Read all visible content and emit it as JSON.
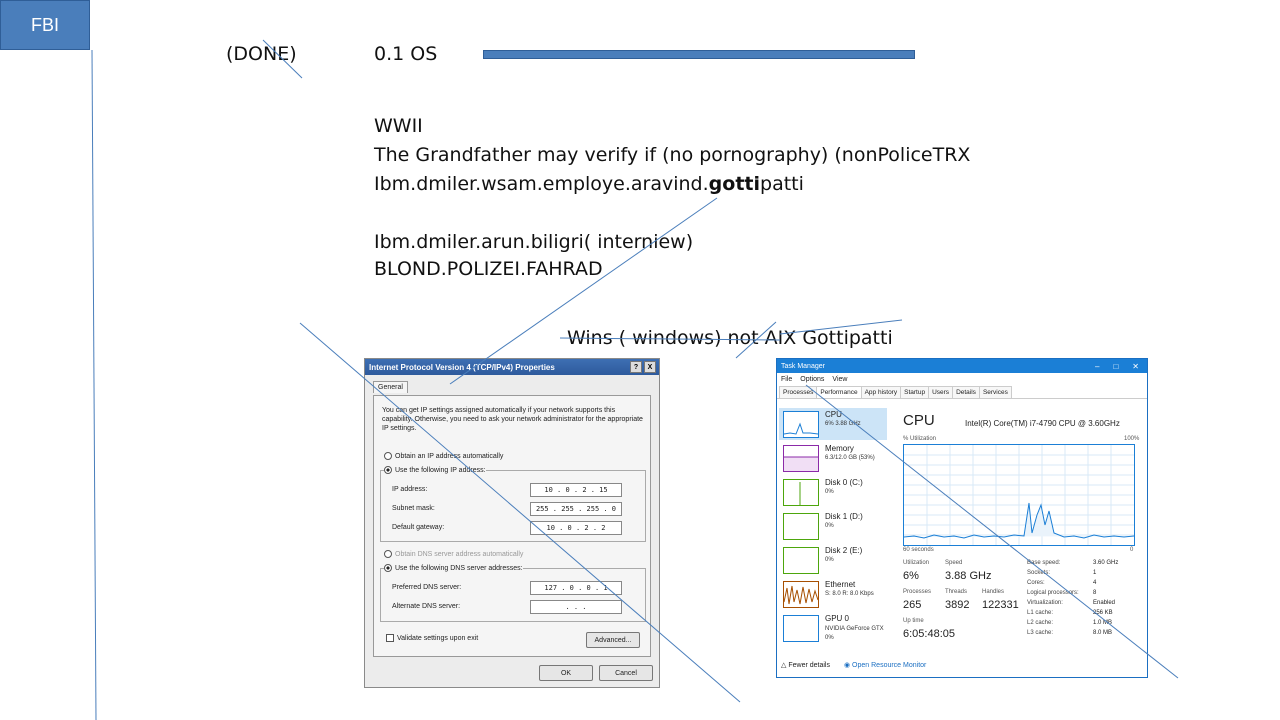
{
  "header": {
    "fbi_label": "FBI"
  },
  "slide": {
    "done": "(DONE)",
    "os": "0.1 OS",
    "line1": "WWII",
    "line2": "The Grandfather may verify if (no pornography) (nonPoliceTRX",
    "line3_prefix": "Ibm.dmiler.wsam.employe.aravind.",
    "line3_bold": "gotti",
    "line3_suffix": "patti",
    "line4": "Ibm.dmiler.arun.biligri( interniew)",
    "line5": "BLOND.POLIZEI.FAHRAD",
    "caption": "Wins ( windows) not AIX Gottipatti"
  },
  "ipv4_dialog": {
    "title": "Internet Protocol Version 4 (TCP/IPv4) Properties",
    "help": "?",
    "close": "X",
    "tab": "General",
    "description": "You can get IP settings assigned automatically if your network supports this capability. Otherwise, you need to ask your network administrator for the appropriate IP settings.",
    "auto_ip": "Obtain an IP address automatically",
    "manual_ip": "Use the following IP address:",
    "ip_label": "IP address:",
    "ip_value": "10 . 0 . 2 . 15",
    "mask_label": "Subnet mask:",
    "mask_value": "255 . 255 . 255 . 0",
    "gw_label": "Default gateway:",
    "gw_value": "10 . 0 . 2 . 2",
    "auto_dns": "Obtain DNS server address automatically",
    "manual_dns": "Use the following DNS server addresses:",
    "pref_dns_label": "Preferred DNS server:",
    "pref_dns_value": "127 . 0 . 0 . 1",
    "alt_dns_label": "Alternate DNS server:",
    "alt_dns_value": ". . .",
    "validate": "Validate settings upon exit",
    "advanced": "Advanced...",
    "ok": "OK",
    "cancel": "Cancel"
  },
  "task_manager": {
    "title": "Task Manager",
    "menu": [
      "File",
      "Options",
      "View"
    ],
    "tabs": [
      "Processes",
      "Performance",
      "App history",
      "Startup",
      "Users",
      "Details",
      "Services"
    ],
    "resources": [
      {
        "name": "CPU",
        "sub": "6% 3.88 GHz"
      },
      {
        "name": "Memory",
        "sub": "6.3/12.0 GB (53%)"
      },
      {
        "name": "Disk 0 (C:)",
        "sub": "0%"
      },
      {
        "name": "Disk 1 (D:)",
        "sub": "0%"
      },
      {
        "name": "Disk 2 (E:)",
        "sub": "0%"
      },
      {
        "name": "Ethernet",
        "sub": "S: 8.0 R: 8.0 Kbps"
      },
      {
        "name": "GPU 0",
        "sub": "NVIDIA GeForce GTX 0%"
      }
    ],
    "cpu_heading": "CPU",
    "cpu_model": "Intel(R) Core(TM) i7-4790 CPU @ 3.60GHz",
    "util_label": "% Utilization",
    "util_max": "100%",
    "time_label": "60 seconds",
    "time_zero": "0",
    "stats": {
      "utilization_label": "Utilization",
      "utilization": "6%",
      "speed_label": "Speed",
      "speed": "3.88 GHz",
      "processes_label": "Processes",
      "processes": "265",
      "threads_label": "Threads",
      "threads": "3892",
      "handles_label": "Handles",
      "handles": "122331",
      "uptime_label": "Up time",
      "uptime": "6:05:48:05"
    },
    "specs": [
      {
        "k": "Base speed:",
        "v": "3.60 GHz"
      },
      {
        "k": "Sockets:",
        "v": "1"
      },
      {
        "k": "Cores:",
        "v": "4"
      },
      {
        "k": "Logical processors:",
        "v": "8"
      },
      {
        "k": "Virtualization:",
        "v": "Enabled"
      },
      {
        "k": "L1 cache:",
        "v": "256 KB"
      },
      {
        "k": "L2 cache:",
        "v": "1.0 MB"
      },
      {
        "k": "L3 cache:",
        "v": "8.0 MB"
      }
    ],
    "fewer_details": "Fewer details",
    "open_monitor": "Open Resource Monitor"
  },
  "colors": {
    "accent": "#4a7ebb",
    "task_manager_blue": "#1b7fd6"
  }
}
